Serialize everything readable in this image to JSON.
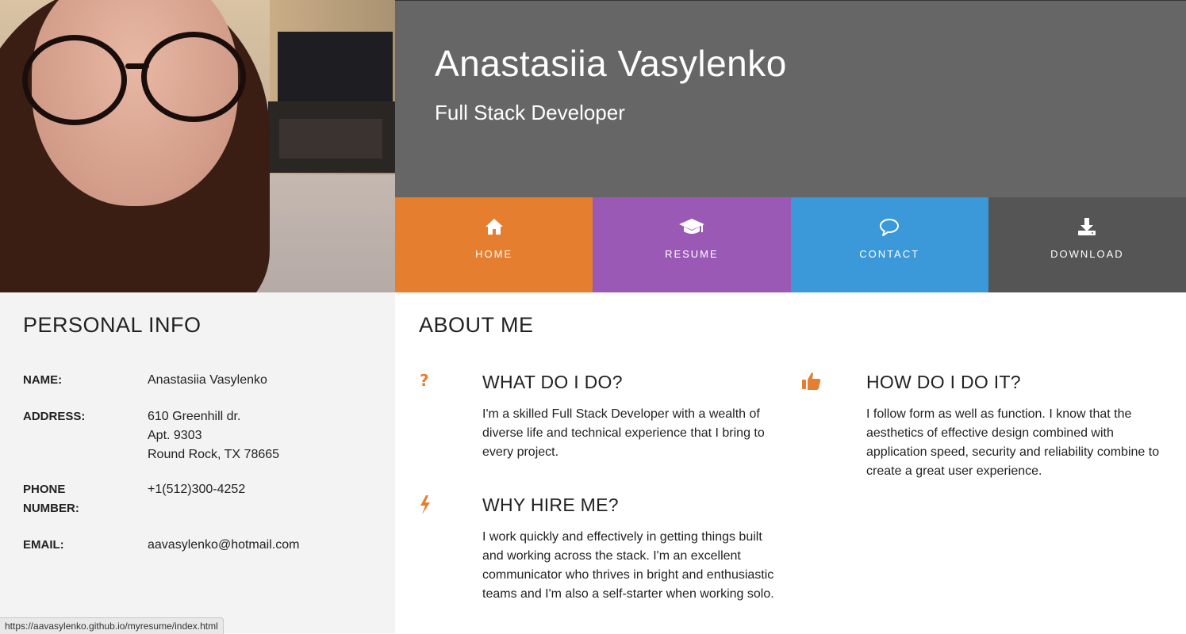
{
  "header": {
    "name": "Anastasiia Vasylenko",
    "role": "Full Stack Developer"
  },
  "nav": [
    {
      "label": "HOME",
      "icon": "home-icon",
      "color": "#e67e2f"
    },
    {
      "label": "RESUME",
      "icon": "graduation-cap-icon",
      "color": "#9b59b6"
    },
    {
      "label": "CONTACT",
      "icon": "speech-bubble-icon",
      "color": "#3b98d9"
    },
    {
      "label": "DOWNLOAD",
      "icon": "download-icon",
      "color": "#555555"
    }
  ],
  "personal": {
    "title": "PERSONAL INFO",
    "name_label": "NAME:",
    "name_value": "Anastasiia Vasylenko",
    "address_label": "ADDRESS:",
    "address_line1": "610 Greenhill dr.",
    "address_line2": "Apt. 9303",
    "address_line3": "Round Rock, TX 78665",
    "phone_label_1": "PHONE",
    "phone_label_2": "NUMBER:",
    "phone_value": "+1(512)300-4252",
    "email_label": "EMAIL:",
    "email_value": "aavasylenko@hotmail.com"
  },
  "about": {
    "title": "ABOUT ME",
    "what": {
      "icon": "question-mark-icon",
      "title": "WHAT DO I DO?",
      "text": "I'm a skilled Full Stack Developer with a wealth of diverse life and technical experience that I bring to every project."
    },
    "how": {
      "icon": "thumbs-up-icon",
      "title": "HOW DO I DO IT?",
      "text": "I follow form as well as function. I know that the aesthetics of effective design combined with application speed, security and reliability combine to create a great user experience."
    },
    "why": {
      "icon": "lightning-bolt-icon",
      "title": "WHY HIRE ME?",
      "text": "I work quickly and effectively in getting things built and working across the stack. I'm an excellent communicator who thrives in bright and enthusiastic teams and I'm also a self-starter when working solo."
    }
  },
  "status_bar": {
    "url": "https://aavasylenko.github.io/myresume/index.html"
  },
  "colors": {
    "accent": "#e67e2f",
    "header_bg": "#666666",
    "left_panel_bg": "#f3f3f3"
  }
}
